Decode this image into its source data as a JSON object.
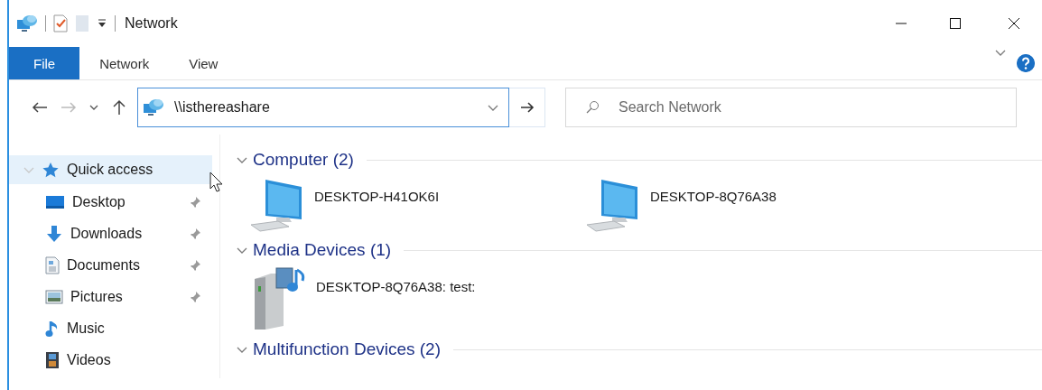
{
  "window": {
    "title": "Network"
  },
  "ribbon_tabs": [
    {
      "label": "File",
      "selected": true
    },
    {
      "label": "Network",
      "selected": false
    },
    {
      "label": "View",
      "selected": false
    }
  ],
  "address_bar": {
    "value": "\\\\isthereashare"
  },
  "search": {
    "placeholder": "Search Network"
  },
  "nav_pane": {
    "items": [
      {
        "label": "Quick access",
        "selected": true,
        "expanded": true,
        "children": [
          {
            "label": "Desktop",
            "pinned": true,
            "selected": false
          },
          {
            "label": "Downloads",
            "pinned": true,
            "selected": false
          },
          {
            "label": "Documents",
            "pinned": true,
            "selected": false
          },
          {
            "label": "Pictures",
            "pinned": true,
            "selected": false
          },
          {
            "label": "Music",
            "pinned": false,
            "selected": false
          },
          {
            "label": "Videos",
            "pinned": false,
            "selected": false
          }
        ]
      }
    ]
  },
  "groups": [
    {
      "title": "Computer (2)",
      "expanded": true,
      "items": [
        {
          "name": "DESKTOP-H41OK6I",
          "kind": "computer"
        },
        {
          "name": "DESKTOP-8Q76A38",
          "kind": "computer"
        }
      ]
    },
    {
      "title": "Media Devices (1)",
      "expanded": true,
      "items": [
        {
          "name": "DESKTOP-8Q76A38: test:",
          "kind": "media"
        }
      ]
    },
    {
      "title": "Multifunction Devices (2)",
      "expanded": true
    }
  ]
}
